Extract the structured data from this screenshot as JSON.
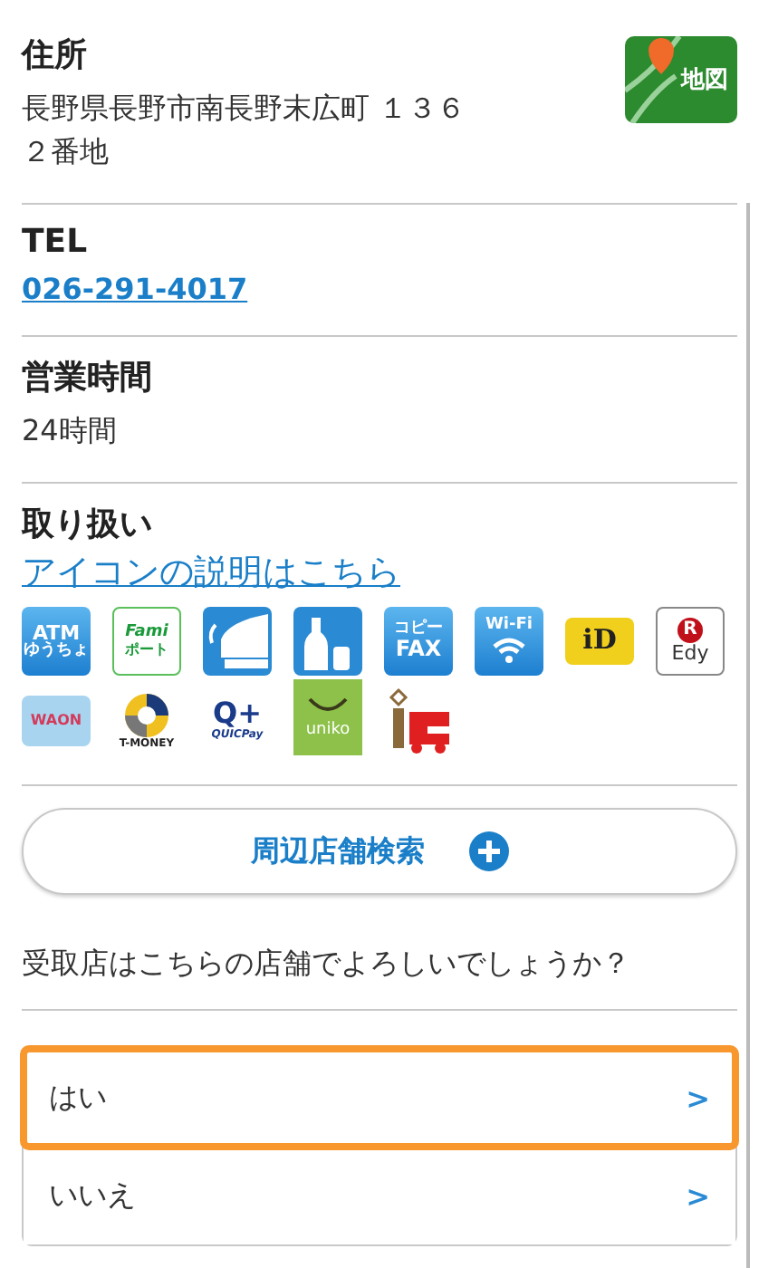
{
  "address": {
    "heading": "住所",
    "lines": [
      "長野県長野市南長野末広町 １３６",
      "２番地"
    ],
    "map_button": "地図"
  },
  "tel": {
    "heading": "TEL",
    "number": "026-291-4017"
  },
  "hours": {
    "heading": "営業時間",
    "value": "24時間"
  },
  "services": {
    "heading": "取り扱い",
    "link": "アイコンの説明はこちら",
    "icons": [
      {
        "kind": "atm",
        "texts": [
          "ATM",
          "ゆうちょ"
        ]
      },
      {
        "kind": "famiport",
        "texts": [
          "Fami",
          "ポート"
        ]
      },
      {
        "kind": "smoking"
      },
      {
        "kind": "liquor"
      },
      {
        "kind": "fax",
        "texts": [
          "コピー",
          "FAX"
        ]
      },
      {
        "kind": "wifi",
        "texts": [
          "Wi-Fi"
        ]
      },
      {
        "kind": "id",
        "texts": [
          "iD"
        ]
      },
      {
        "kind": "edy",
        "texts": [
          "R",
          "Edy"
        ]
      },
      {
        "kind": "waon",
        "texts": [
          "WAON"
        ]
      },
      {
        "kind": "tmoney",
        "texts": [
          "T-MONEY"
        ]
      },
      {
        "kind": "quicpay",
        "texts": [
          "Q+",
          "QUICPay"
        ]
      },
      {
        "kind": "uniko",
        "texts": [
          "uniko"
        ]
      },
      {
        "kind": "ic"
      }
    ]
  },
  "search_button": "周辺店舗検索",
  "question": "受取店はこちらの店舗でよろしいでしょうか？",
  "choices": [
    {
      "label": "はい",
      "selected": true,
      "arrow": ">"
    },
    {
      "label": "いいえ",
      "selected": false,
      "arrow": ">"
    }
  ]
}
